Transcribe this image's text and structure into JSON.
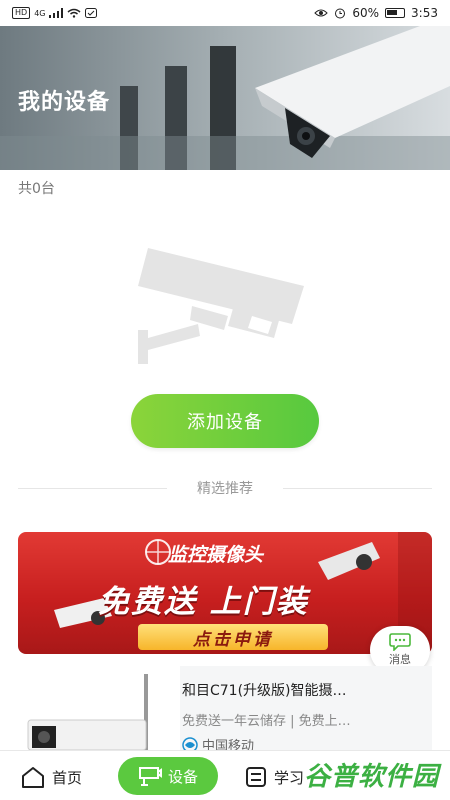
{
  "status_bar": {
    "network": "4G",
    "battery": "60%",
    "time": "3:53",
    "hd": "HD"
  },
  "hero": {
    "title": "我的设备"
  },
  "devices": {
    "count_label": "共0台"
  },
  "empty_state": {
    "add_button": "添加设备"
  },
  "recommend": {
    "section_label": "精选推荐"
  },
  "banner": {
    "headline": "监控摄像头",
    "main": "免费送  上门装",
    "cta": "点击申请"
  },
  "chat": {
    "label": "消息"
  },
  "product": {
    "title": "和目C71(升级版)智能摄…",
    "subtitle": "免费送一年云储存 | 免费上…",
    "brand": "中国移动"
  },
  "tabbar": {
    "home": "首页",
    "devices": "设备",
    "learn": "学习"
  },
  "watermark": {
    "text": "谷普软件园"
  },
  "colors": {
    "accent": "#5bc93f",
    "banner_red": "#d42a25"
  }
}
